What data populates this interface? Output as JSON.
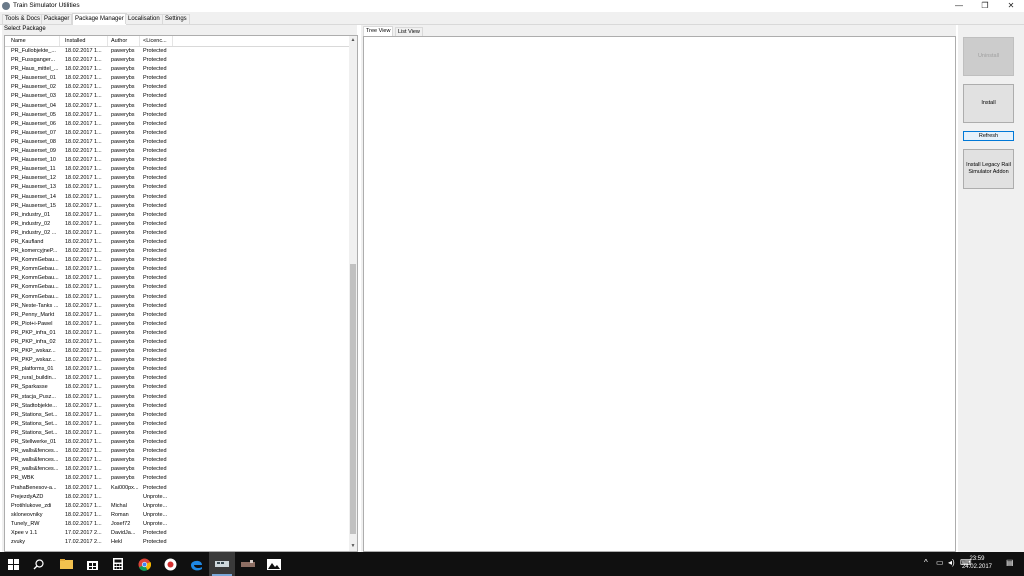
{
  "window": {
    "title": "Train Simulator Utilities",
    "minimize": "—",
    "maximize": "❐",
    "close": "✕"
  },
  "main_tabs": [
    {
      "label": "Tools & Docs"
    },
    {
      "label": "Packager"
    },
    {
      "label": "Package Manager"
    },
    {
      "label": "Localisation"
    },
    {
      "label": "Settings"
    }
  ],
  "left_panel": {
    "caption": "Select Package",
    "columns": [
      "Name",
      "Installed",
      "Author",
      "<Licenc..."
    ],
    "rows": [
      [
        "PR_Fullobjekte_...",
        "18.02.2017 1...",
        "pawerybs",
        "Protected"
      ],
      [
        "PR_Fussganger...",
        "18.02.2017 1...",
        "pawerybs",
        "Protected"
      ],
      [
        "PR_Haus_mittel_...",
        "18.02.2017 1...",
        "pawerybs",
        "Protected"
      ],
      [
        "PR_Hauserset_01",
        "18.02.2017 1...",
        "pawerybs",
        "Protected"
      ],
      [
        "PR_Hauserset_02",
        "18.02.2017 1...",
        "pawerybs",
        "Protected"
      ],
      [
        "PR_Hauserset_03",
        "18.02.2017 1...",
        "pawerybs",
        "Protected"
      ],
      [
        "PR_Hauserset_04",
        "18.02.2017 1...",
        "pawerybs",
        "Protected"
      ],
      [
        "PR_Hauserset_05",
        "18.02.2017 1...",
        "pawerybs",
        "Protected"
      ],
      [
        "PR_Hauserset_06",
        "18.02.2017 1...",
        "pawerybs",
        "Protected"
      ],
      [
        "PR_Hauserset_07",
        "18.02.2017 1...",
        "pawerybs",
        "Protected"
      ],
      [
        "PR_Hauserset_08",
        "18.02.2017 1...",
        "pawerybs",
        "Protected"
      ],
      [
        "PR_Hauserset_09",
        "18.02.2017 1...",
        "pawerybs",
        "Protected"
      ],
      [
        "PR_Hauserset_10",
        "18.02.2017 1...",
        "pawerybs",
        "Protected"
      ],
      [
        "PR_Hauserset_11",
        "18.02.2017 1...",
        "pawerybs",
        "Protected"
      ],
      [
        "PR_Hauserset_12",
        "18.02.2017 1...",
        "pawerybs",
        "Protected"
      ],
      [
        "PR_Hauserset_13",
        "18.02.2017 1...",
        "pawerybs",
        "Protected"
      ],
      [
        "PR_Hauserset_14",
        "18.02.2017 1...",
        "pawerybs",
        "Protected"
      ],
      [
        "PR_Hauserset_15",
        "18.02.2017 1...",
        "pawerybs",
        "Protected"
      ],
      [
        "PR_industry_01",
        "18.02.2017 1...",
        "pawerybs",
        "Protected"
      ],
      [
        "PR_industry_02",
        "18.02.2017 1...",
        "pawerybs",
        "Protected"
      ],
      [
        "PR_industry_02 ...",
        "18.02.2017 1...",
        "pawerybs",
        "Protected"
      ],
      [
        "PR_Kaufland",
        "18.02.2017 1...",
        "pawerybs",
        "Protected"
      ],
      [
        "PR_komercyjneP...",
        "18.02.2017 1...",
        "pawerybs",
        "Protected"
      ],
      [
        "PR_KommGebau...",
        "18.02.2017 1...",
        "pawerybs",
        "Protected"
      ],
      [
        "PR_KommGebau...",
        "18.02.2017 1...",
        "pawerybs",
        "Protected"
      ],
      [
        "PR_KommGebau...",
        "18.02.2017 1...",
        "pawerybs",
        "Protected"
      ],
      [
        "PR_KommGebau...",
        "18.02.2017 1...",
        "pawerybs",
        "Protected"
      ],
      [
        "PR_KommGebau...",
        "18.02.2017 1...",
        "pawerybs",
        "Protected"
      ],
      [
        "PR_Neste-Tanks ...",
        "18.02.2017 1...",
        "pawerybs",
        "Protected"
      ],
      [
        "PR_Penny_Markt",
        "18.02.2017 1...",
        "pawerybs",
        "Protected"
      ],
      [
        "PR_Piot+i-Pawel",
        "18.02.2017 1...",
        "pawerybs",
        "Protected"
      ],
      [
        "PR_PKP_infra_01",
        "18.02.2017 1...",
        "pawerybs",
        "Protected"
      ],
      [
        "PR_PKP_infra_02",
        "18.02.2017 1...",
        "pawerybs",
        "Protected"
      ],
      [
        "PR_PKP_wskaz...",
        "18.02.2017 1...",
        "pawerybs",
        "Protected"
      ],
      [
        "PR_PKP_wskaz...",
        "18.02.2017 1...",
        "pawerybs",
        "Protected"
      ],
      [
        "PR_platforms_01",
        "18.02.2017 1...",
        "pawerybs",
        "Protected"
      ],
      [
        "PR_rural_buildin...",
        "18.02.2017 1...",
        "pawerybs",
        "Protected"
      ],
      [
        "PR_Sparkasse",
        "18.02.2017 1...",
        "pawerybs",
        "Protected"
      ],
      [
        "PR_stacja_Pusz...",
        "18.02.2017 1...",
        "pawerybs",
        "Protected"
      ],
      [
        "PR_Stadtobjekte...",
        "18.02.2017 1...",
        "pawerybs",
        "Protected"
      ],
      [
        "PR_Stations_Set...",
        "18.02.2017 1...",
        "pawerybs",
        "Protected"
      ],
      [
        "PR_Stations_Set...",
        "18.02.2017 1...",
        "pawerybs",
        "Protected"
      ],
      [
        "PR_Stations_Set...",
        "18.02.2017 1...",
        "pawerybs",
        "Protected"
      ],
      [
        "PR_Stellwerke_01",
        "18.02.2017 1...",
        "pawerybs",
        "Protected"
      ],
      [
        "PR_walls&fences...",
        "18.02.2017 1...",
        "pawerybs",
        "Protected"
      ],
      [
        "PR_walls&fences...",
        "18.02.2017 1...",
        "pawerybs",
        "Protected"
      ],
      [
        "PR_walls&fences...",
        "18.02.2017 1...",
        "pawerybs",
        "Protected"
      ],
      [
        "PR_WBK",
        "18.02.2017 1...",
        "pawerybs",
        "Protected"
      ],
      [
        "PrahaBenesov-a...",
        "18.02.2017 1...",
        "Kai000px...",
        "Protected"
      ],
      [
        "PrejezdyAZD",
        "18.02.2017 1...",
        "",
        "Unprote..."
      ],
      [
        "Protihlukove_zdi",
        "18.02.2017 1...",
        "Michal",
        "Unprote..."
      ],
      [
        "skloneovniky",
        "18.02.2017 1...",
        "Roman",
        "Unprote..."
      ],
      [
        "Tunely_RW",
        "18.02.2017 1...",
        "Josef72",
        "Unprote..."
      ],
      [
        "Xpee v 1.1",
        "17.02.2017 2...",
        "DavidJa...",
        "Protected"
      ],
      [
        "zvuky",
        "17.02.2017 2...",
        "Hekl",
        "Protected"
      ]
    ]
  },
  "middle_panel": {
    "tabs": [
      {
        "label": "Tree View"
      },
      {
        "label": "List View"
      }
    ]
  },
  "right_panel": {
    "uninstall": "Uninstall",
    "install": "Install",
    "refresh": "Refresh",
    "install_legacy": "Install Legacy Rail Simulator Addon"
  },
  "taskbar": {
    "time": "23:59",
    "date": "24.02.2017"
  }
}
